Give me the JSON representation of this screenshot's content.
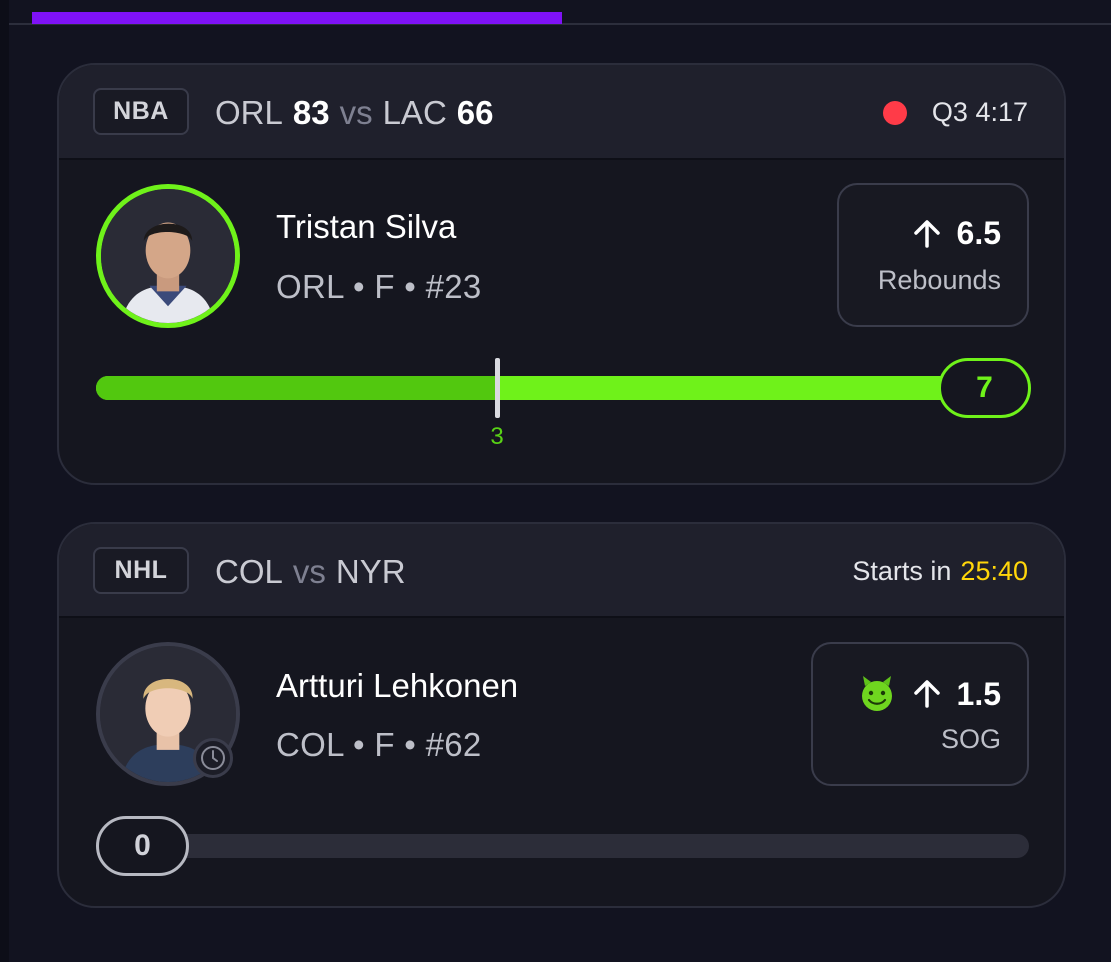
{
  "colors": {
    "accent_purple": "#7f12f6",
    "progress_green": "#6ff21a",
    "live_red": "#ff3b48",
    "countdown_yellow": "#ffd60a"
  },
  "cards": [
    {
      "league": "NBA",
      "home_team": "ORL",
      "home_score": "83",
      "vs_label": "vs",
      "away_team": "LAC",
      "away_score": "66",
      "status_icon": "live-dot",
      "status_text": "Q3 4:17",
      "player_name": "Tristan Silva",
      "player_meta": "ORL • F • #23",
      "line_icon": "arrow-up-icon",
      "line_value": "6.5",
      "stat_type": "Rebounds",
      "current_value": "7",
      "progress_fraction": 1.0,
      "marker_value": "3",
      "marker_fraction": 0.43
    },
    {
      "league": "NHL",
      "home_team": "COL",
      "vs_label": "vs",
      "away_team": "NYR",
      "status_prefix": "Starts in",
      "countdown": "25:40",
      "player_name": "Artturi Lehkonen",
      "player_meta": "COL • F • #62",
      "badge_icon": "devil-emoji-icon",
      "line_icon": "arrow-up-icon",
      "line_value": "1.5",
      "stat_type": "SOG",
      "current_value": "0",
      "progress_fraction": 0.0,
      "avatar_badge_icon": "clock-icon"
    }
  ]
}
